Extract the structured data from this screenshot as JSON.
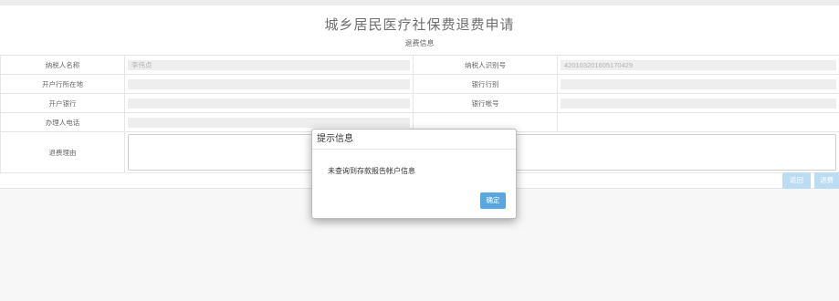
{
  "page": {
    "title": "城乡居民医疗社保费退费申请",
    "section_title": "退费信息"
  },
  "form": {
    "taxpayer_name_label": "纳税人名称",
    "taxpayer_name_value": "李伟贞",
    "taxpayer_id_label": "纳税人识别号",
    "taxpayer_id_value": "420103201605170429",
    "bank_location_label": "开户行所在地",
    "bank_location_value": "",
    "bank_type_label": "银行行别",
    "bank_type_value": "",
    "bank_label": "开户银行",
    "bank_value": "",
    "account_label": "银行帐号",
    "account_value": "",
    "phone_label": "办理人电话",
    "phone_value": "",
    "reason_label": "退费理由",
    "reason_value": ""
  },
  "actions": {
    "back_label": "返回",
    "refund_label": "退费"
  },
  "modal": {
    "title": "提示信息",
    "message": "未查询到存款报告帐户信息",
    "ok_label": "确定"
  }
}
